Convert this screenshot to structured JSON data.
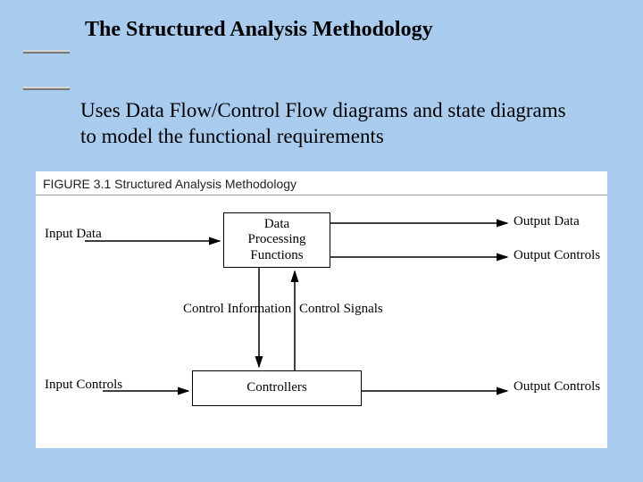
{
  "title": "The Structured Analysis Methodology",
  "subtitle": "Uses Data Flow/Control Flow diagrams and state diagrams  to model the functional requirements",
  "figure": {
    "caption": "FIGURE 3.1  Structured Analysis Methodology",
    "boxes": {
      "data_processing": "Data\nProcessing\nFunctions",
      "controllers": "Controllers"
    },
    "labels": {
      "input_data": "Input\nData",
      "input_controls": "Input\nControls",
      "output_data": "Output Data",
      "output_controls_top": "Output\nControls",
      "output_controls_bottom": "Output\nControls",
      "control_information": "Control\nInformation",
      "control_signals": "Control\nSignals"
    }
  }
}
